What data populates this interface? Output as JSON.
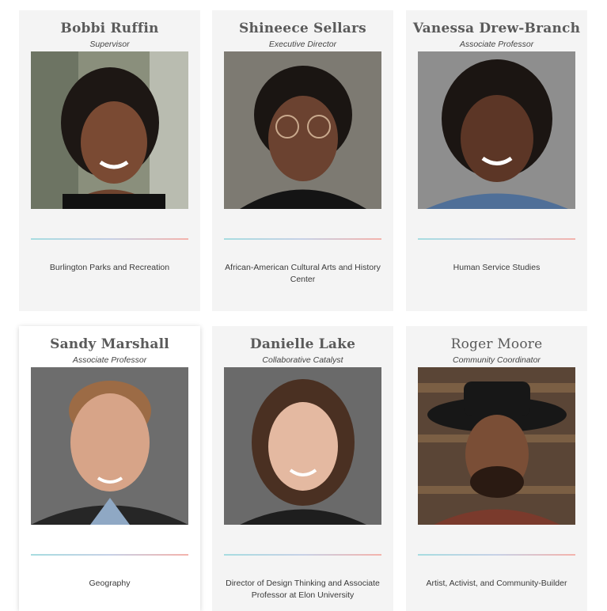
{
  "people": [
    {
      "name": "Bobbi Ruffin",
      "role": "Supervisor",
      "org": "Burlington Parks and Recreation"
    },
    {
      "name": "Shineece Sellars",
      "role": "Executive Director",
      "org": "African-American Cultural Arts and History Center"
    },
    {
      "name": "Vanessa Drew-Branch",
      "role": "Associate Professor",
      "org": "Human Service Studies"
    },
    {
      "name": "Sandy Marshall",
      "role": "Associate Professor",
      "org": "Geography"
    },
    {
      "name": "Danielle Lake",
      "role": "Collaborative Catalyst",
      "org": "Director of Design Thinking and Associate Professor at Elon University"
    },
    {
      "name": "Roger Moore",
      "role": "Community Coordinator",
      "org": "Artist, Activist, and Community-Builder"
    }
  ],
  "colors": {
    "card_bg": "#f4f4f4",
    "name": "#5a5a5a",
    "divider_start": "#a7dce0",
    "divider_end": "#f4b3ac"
  }
}
